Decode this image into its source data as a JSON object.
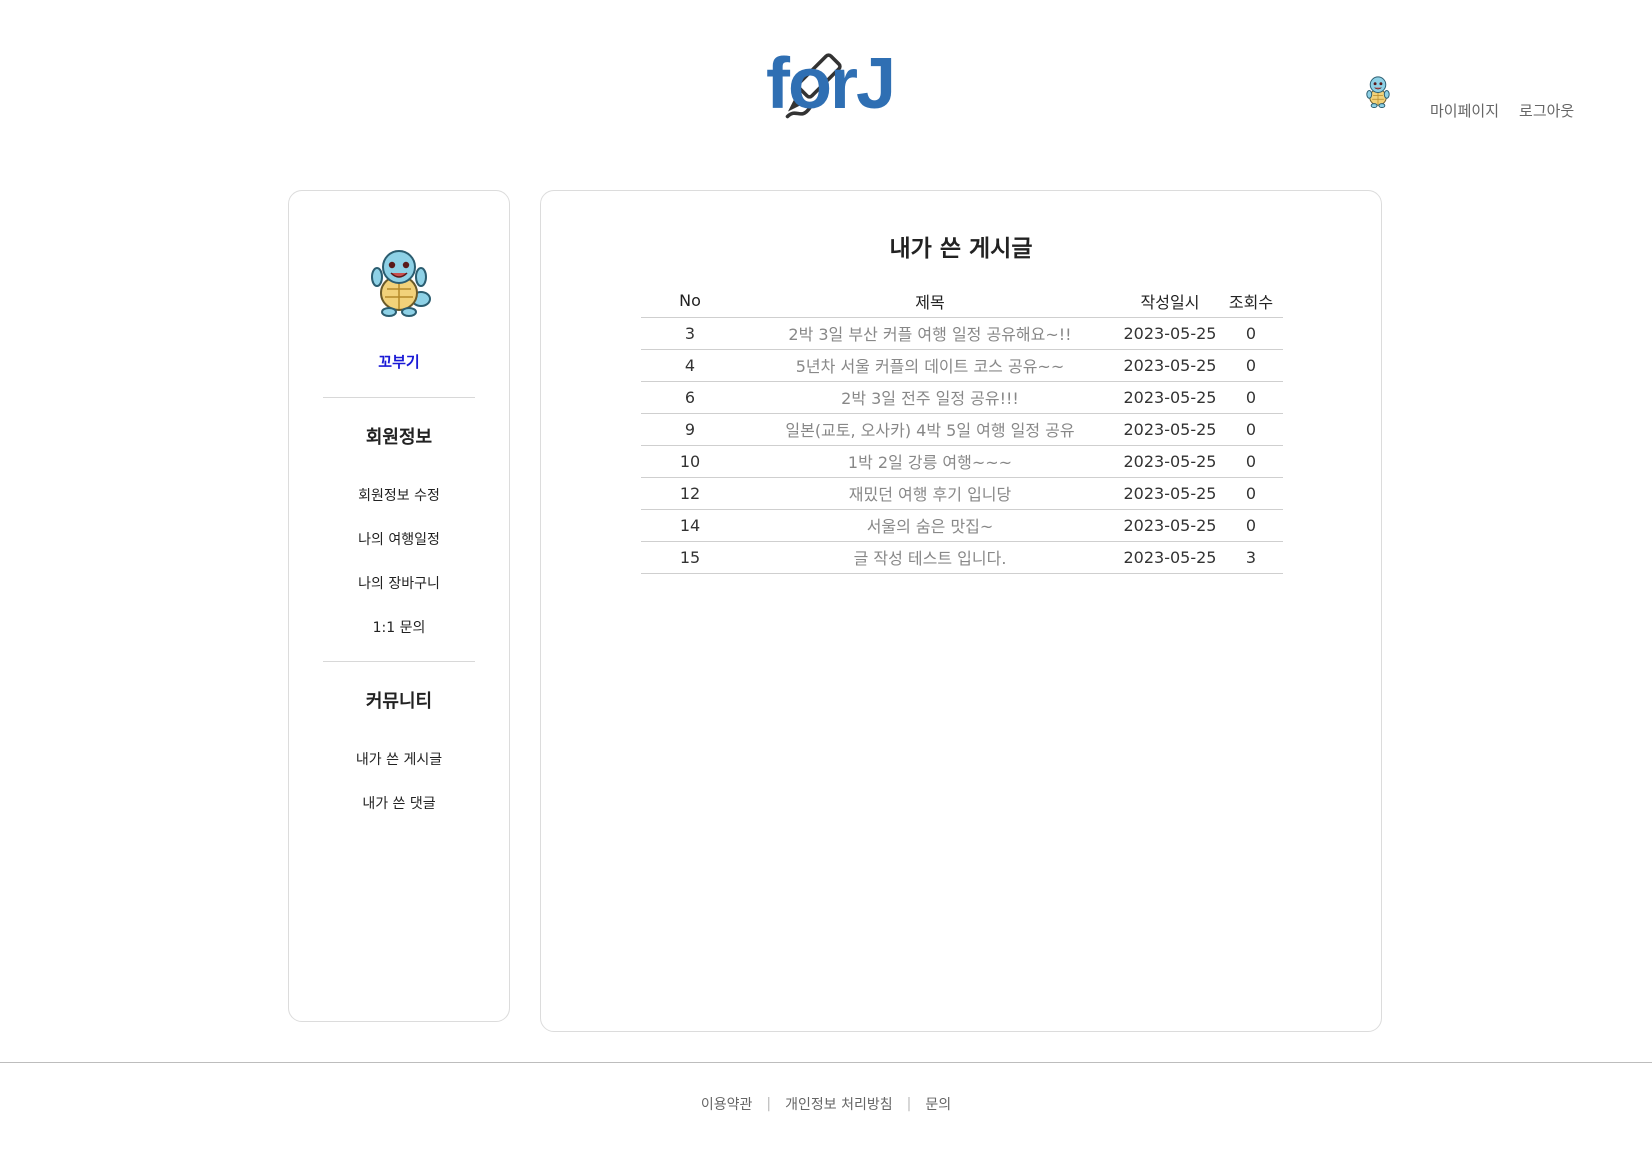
{
  "header": {
    "logo_text": "forJ",
    "links": [
      "마이페이지",
      "로그아웃"
    ]
  },
  "sidebar": {
    "nickname": "꼬부기",
    "sections": [
      {
        "title": "회원정보",
        "items": [
          "회원정보 수정",
          "나의 여행일정",
          "나의 장바구니",
          "1:1 문의"
        ]
      },
      {
        "title": "커뮤니티",
        "items": [
          "내가 쓴 게시글",
          "내가 쓴 댓글"
        ]
      }
    ]
  },
  "main": {
    "title": "내가 쓴 게시글",
    "columns": [
      "No",
      "제목",
      "작성일시",
      "조회수"
    ],
    "rows": [
      [
        "3",
        "2박 3일 부산 커플 여행 일정 공유해요~!!",
        "2023-05-25",
        "0"
      ],
      [
        "4",
        "5년차 서울 커플의 데이트 코스 공유~~",
        "2023-05-25",
        "0"
      ],
      [
        "6",
        "2박 3일 전주 일정 공유!!!",
        "2023-05-25",
        "0"
      ],
      [
        "9",
        "일본(교토, 오사카) 4박 5일 여행 일정 공유",
        "2023-05-25",
        "0"
      ],
      [
        "10",
        "1박 2일 강릉 여행~~~",
        "2023-05-25",
        "0"
      ],
      [
        "12",
        "재밌던 여행 후기 입니당",
        "2023-05-25",
        "0"
      ],
      [
        "14",
        "서울의 숨은 맛집~",
        "2023-05-25",
        "0"
      ],
      [
        "15",
        "글 작성 테스트 입니다.",
        "2023-05-25",
        "3"
      ]
    ]
  },
  "footer": {
    "links": [
      "이용약관",
      "개인정보 처리방침",
      "문의"
    ],
    "separator": "|"
  },
  "colors": {
    "brand": "#2f6fb3",
    "nickname": "#1a1ad6",
    "border": "#dcdcdc"
  },
  "icons": {
    "logo_pencil": "pencil-icon",
    "avatar": "squirtle-avatar"
  }
}
